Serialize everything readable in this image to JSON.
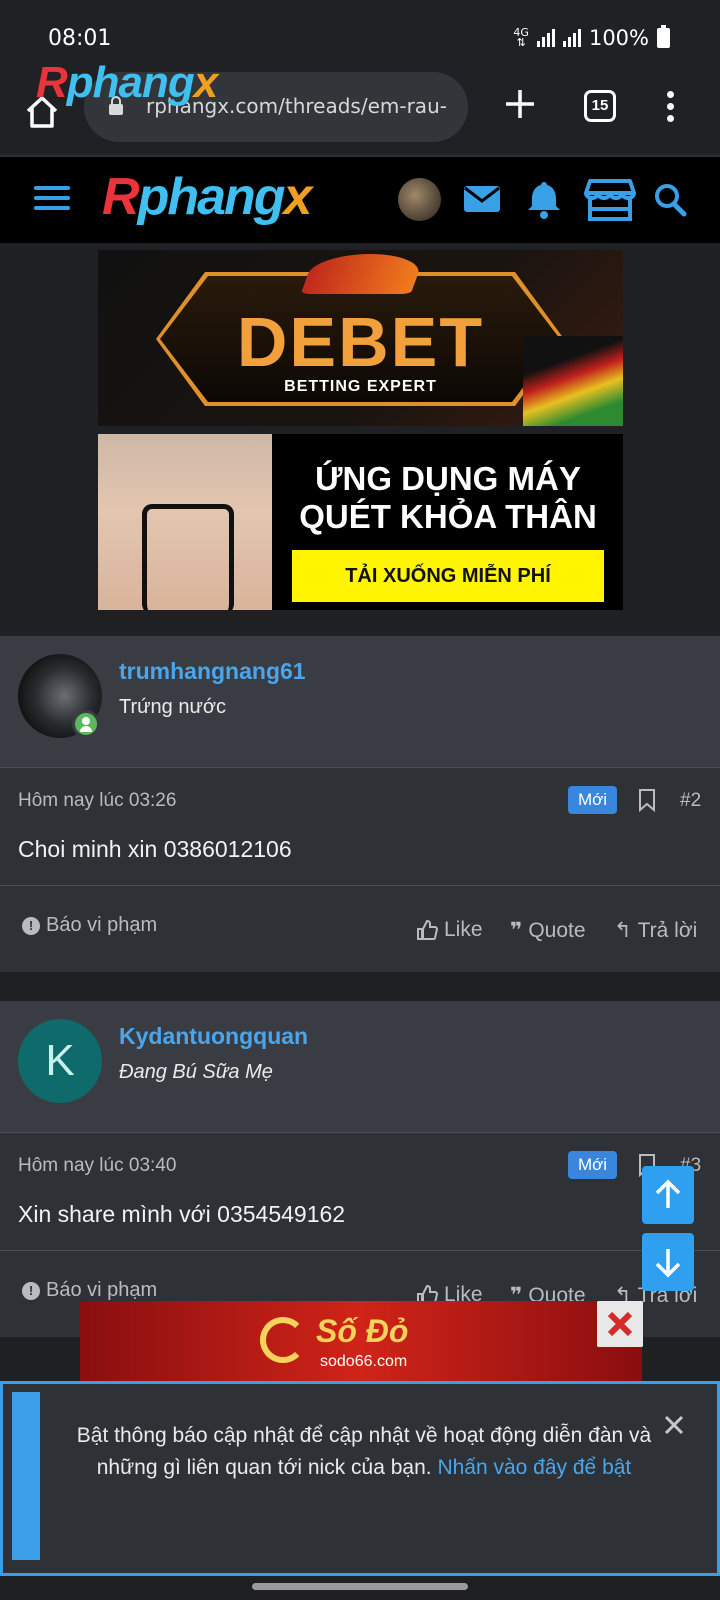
{
  "status": {
    "time": "08:01",
    "network": "4G",
    "battery": "100%"
  },
  "browser": {
    "url": "rphangx.com/threads/em-rau-",
    "tab_count": "15",
    "logo_overlay": "Rphangx"
  },
  "site": {
    "brand_parts": [
      "R",
      "phang",
      "x"
    ]
  },
  "ads": {
    "debet_title": "DEBET",
    "debet_sub": "BETTING EXPERT",
    "app_headline_1": "ỨNG DỤNG MÁY",
    "app_headline_2": "QUÉT KHỎA THÂN",
    "app_cta": "TẢI XUỐNG MIỄN PHÍ",
    "bottom_logo": "Số Đỏ",
    "bottom_sub": "sodo66.com"
  },
  "posts": [
    {
      "username": "trumhangnang61",
      "user_title": "Trứng nước",
      "date": "Hôm nay lúc 03:26",
      "badge": "Mới",
      "number": "#2",
      "text": "Choi minh xin 0386012106"
    },
    {
      "avatar_letter": "K",
      "username": "Kydantuongquan",
      "user_title": "Đang Bú Sữa Mẹ",
      "date": "Hôm nay lúc 03:40",
      "badge": "Mới",
      "number": "#3",
      "text": "Xin share mình với 0354549162"
    }
  ],
  "actions": {
    "report": "Báo vi phạm",
    "like": "Like",
    "quote": "Quote",
    "reply": "Trả lời"
  },
  "notification": {
    "message": "Bật thông báo cập nhật để cập nhật về hoạt động diễn đàn và những gì liên quan tới nick của bạn.",
    "link": "Nhấn vào đây để bật"
  }
}
